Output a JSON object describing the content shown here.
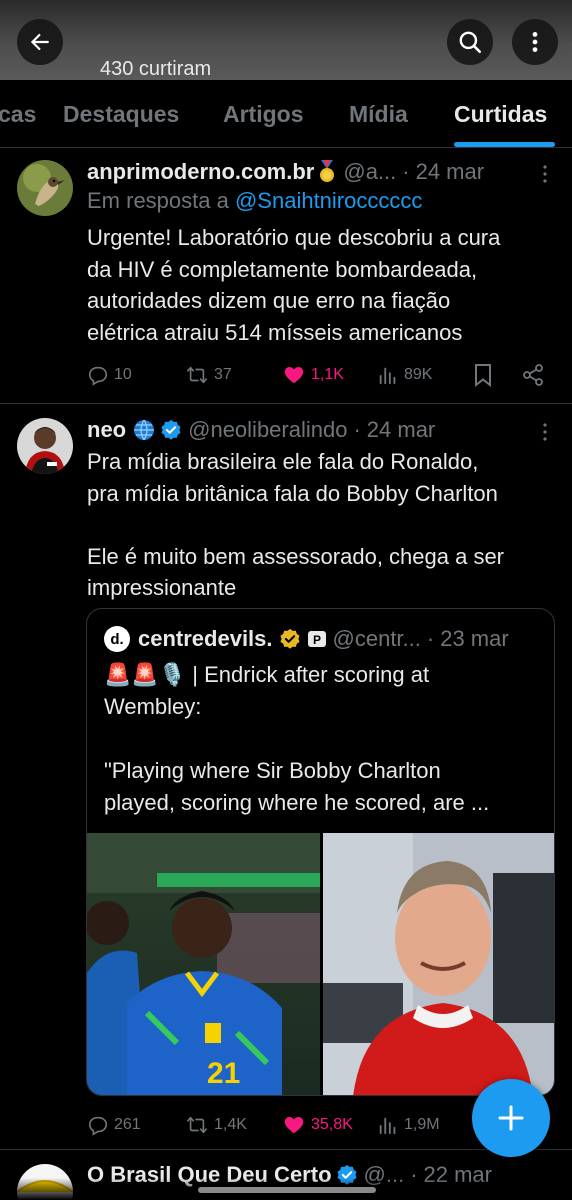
{
  "header": {
    "likes_count": "430 curtiram",
    "back_icon": "arrow-left-icon",
    "search_icon": "search-icon",
    "more_icon": "more-vertical-icon"
  },
  "tabs": [
    {
      "label": "cas"
    },
    {
      "label": "Destaques"
    },
    {
      "label": "Artigos"
    },
    {
      "label": "Mídia"
    },
    {
      "label": "Curtidas",
      "active": true
    }
  ],
  "tweets": [
    {
      "name": "anprimoderno.com.br",
      "handle": "@a...",
      "date": "24 mar",
      "reply_prefix": "Em resposta a",
      "reply_to": "@Snaihtnirocccccc",
      "text": "Urgente! Laboratório que descobriu a cura\nda HIV é completamente bombardeada,\nautoridades dizem que erro na fiação\nelétrica atraiu 514 mísseis americanos",
      "replies": "10",
      "retweets": "37",
      "likes": "1,1K",
      "views": "89K"
    },
    {
      "name": "neo",
      "handle": "@neoliberalindo",
      "date": "24 mar",
      "text": "Pra mídia brasileira ele fala do Ronaldo,\npra mídia britânica fala do Bobby Charlton\n\nEle é muito bem assessorado, chega a ser\nimpressionante",
      "replies": "261",
      "retweets": "1,4K",
      "likes": "35,8K",
      "views": "1,9M",
      "quote": {
        "name": "centredevils.",
        "handle": "@centr...",
        "date": "23 mar",
        "text": "🚨🚨🎙️ | Endrick after scoring at\nWembley:\n\n\"Playing where Sir Bobby Charlton\nplayed, scoring where he scored, are ..."
      }
    },
    {
      "name": "O Brasil Que Deu Certo",
      "handle": "@...",
      "date": "22 mar"
    }
  ],
  "colors": {
    "accent": "#1d9bf0",
    "like": "#f91880",
    "verified_gold": "#e8b923",
    "muted": "#71767b",
    "border": "#2f3336"
  },
  "fab": {
    "icon": "plus-icon"
  }
}
